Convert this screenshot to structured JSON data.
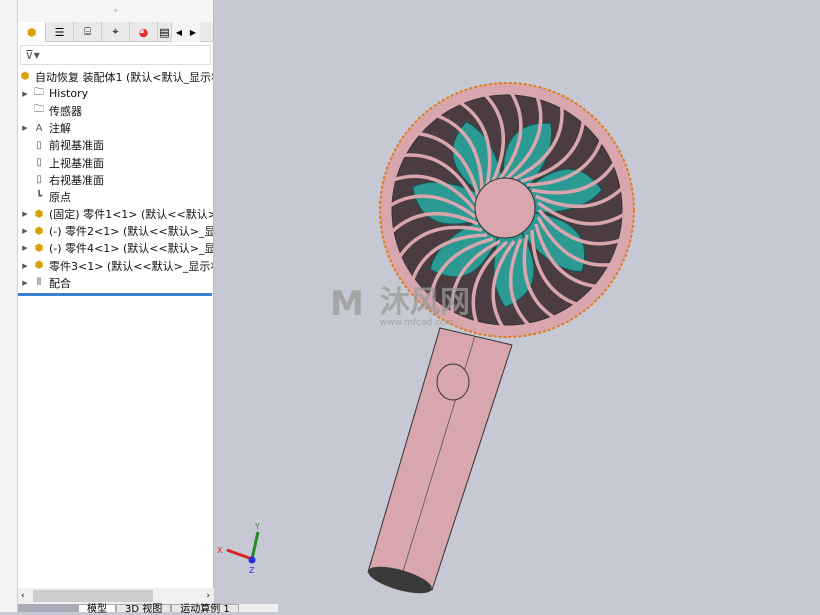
{
  "feature_tree": {
    "tabs": [
      "feature-manager",
      "property-manager",
      "configuration-manager",
      "dimxpert-manager",
      "display-manager",
      "cam"
    ],
    "filter_icon": "funnel-icon",
    "root": "自动恢复 装配体1  (默认<默认_显示状",
    "items": [
      {
        "label": "History",
        "icon": "history-folder-icon",
        "expandable": true
      },
      {
        "label": "传感器",
        "icon": "sensor-folder-icon",
        "expandable": false
      },
      {
        "label": "注解",
        "icon": "annotation-folder-icon",
        "expandable": true
      },
      {
        "label": "前视基准面",
        "icon": "plane-icon",
        "expandable": false
      },
      {
        "label": "上视基准面",
        "icon": "plane-icon",
        "expandable": false
      },
      {
        "label": "右视基准面",
        "icon": "plane-icon",
        "expandable": false
      },
      {
        "label": "原点",
        "icon": "origin-icon",
        "expandable": false
      },
      {
        "label": "(固定) 零件1<1> (默认<<默认>_",
        "icon": "part-icon",
        "expandable": true
      },
      {
        "label": "(-) 零件2<1> (默认<<默认>_显示",
        "icon": "part-icon",
        "expandable": true
      },
      {
        "label": "(-) 零件4<1> (默认<<默认>_显示",
        "icon": "part-icon",
        "expandable": true
      },
      {
        "label": "零件3<1> (默认<<默认>_显示状",
        "icon": "part-icon",
        "expandable": true
      },
      {
        "label": "配合",
        "icon": "mates-icon",
        "expandable": true
      }
    ]
  },
  "bottom_tabs": [
    "模型",
    "3D 视图",
    "运动算例 1"
  ],
  "viewport": {
    "watermark": "沐风网",
    "watermark_url": "www.mfcad.com",
    "triad": {
      "x": "X",
      "y": "Y",
      "z": "Z"
    },
    "colors": {
      "body": "#d9a6ad",
      "blades": "#2a9a92",
      "background": "#c6c9d3",
      "edge": "#e07b1e"
    }
  }
}
